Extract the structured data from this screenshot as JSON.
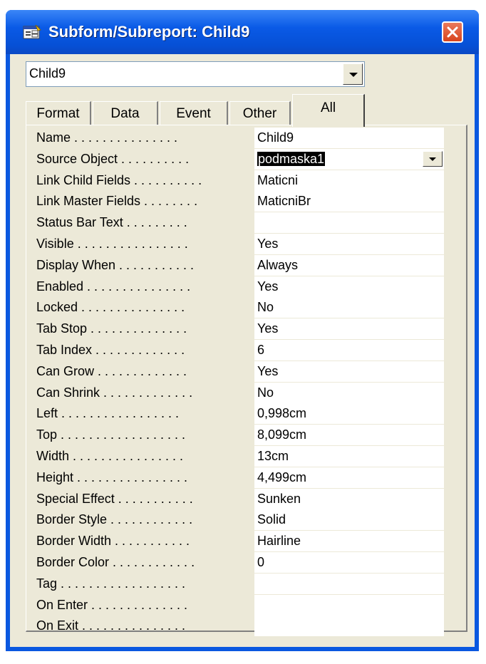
{
  "window": {
    "title": "Subform/Subreport: Child9"
  },
  "object_selector": {
    "value": "Child9"
  },
  "tabs": [
    {
      "label": "Format"
    },
    {
      "label": "Data"
    },
    {
      "label": "Event"
    },
    {
      "label": "Other"
    },
    {
      "label": "All",
      "active": true
    }
  ],
  "properties": [
    {
      "label": "Name . . . . . . . . . . . . . . .",
      "value": "Child9"
    },
    {
      "label": "Source Object . . . . . . . . . .",
      "value": "podmaska1",
      "selected": true,
      "dropdown": true
    },
    {
      "label": "Link Child Fields . . . . . . . . . .",
      "value": "Maticni"
    },
    {
      "label": "Link Master Fields . . . . . . . .",
      "value": "MaticniBr"
    },
    {
      "label": "Status Bar Text . . . . . . . . .",
      "value": ""
    },
    {
      "label": "Visible . . . . . . . . . . . . . . . .",
      "value": "Yes"
    },
    {
      "label": "Display When . . . . . . . . . . .",
      "value": "Always"
    },
    {
      "label": "Enabled . . . . . . . . . . . . . . .",
      "value": "Yes"
    },
    {
      "label": "Locked . . . . . . . . . . . . . . .",
      "value": "No"
    },
    {
      "label": "Tab Stop . . . . . . . . . . . . . .",
      "value": "Yes"
    },
    {
      "label": "Tab Index . . . . . . . . . . . . .",
      "value": "6"
    },
    {
      "label": "Can Grow . . . . . . . . . . . . .",
      "value": "Yes"
    },
    {
      "label": "Can Shrink . . . . . . . . . . . . .",
      "value": "No"
    },
    {
      "label": "Left . . . . . . . . . . . . . . . . .",
      "value": "0,998cm"
    },
    {
      "label": "Top . . . . . . . . . . . . . . . . . .",
      "value": "8,099cm"
    },
    {
      "label": "Width . . . . . . . . . . . . . . . .",
      "value": "13cm"
    },
    {
      "label": "Height . . . . . . . . . . . . . . . .",
      "value": "4,499cm"
    },
    {
      "label": "Special Effect . . . . . . . . . . .",
      "value": "Sunken"
    },
    {
      "label": "Border Style . . . . . . . . . . . .",
      "value": "Solid"
    },
    {
      "label": "Border Width . . . . . . . . . . .",
      "value": "Hairline"
    },
    {
      "label": "Border Color . . . . . . . . . . . .",
      "value": "0"
    },
    {
      "label": "Tag . . . . . . . . . . . . . . . . . .",
      "value": ""
    },
    {
      "label": "On Enter . . . . . . . . . . . . . .",
      "value": ""
    },
    {
      "label": "On Exit . . . . . . . . . . . . . . .",
      "value": ""
    }
  ],
  "colors": {
    "title_bar": "#0a58e0",
    "dialog_face": "#ece9d8",
    "close_button": "#d8441c"
  }
}
